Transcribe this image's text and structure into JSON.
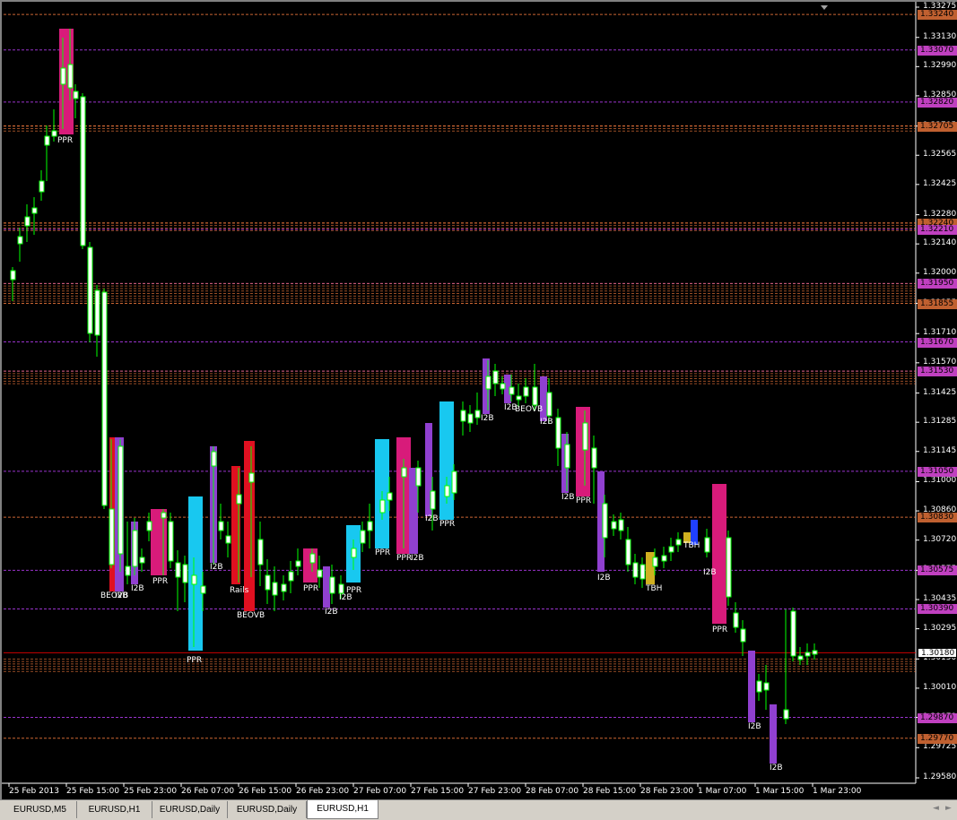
{
  "chart": {
    "symbol": "EURUSD",
    "timeframe": "H1",
    "colors": {
      "background": "#000000",
      "bull_candle": "#ffffff",
      "candle_outline": "#00ff00",
      "level_purple": "#c040ff",
      "level_orange": "#ff8040",
      "current_price_line": "#ff0000"
    }
  },
  "price_axis": {
    "labels": [
      "1.33275",
      "1.33130",
      "1.32990",
      "1.32850",
      "1.32705",
      "1.32565",
      "1.32425",
      "1.32280",
      "1.32140",
      "1.32000",
      "1.31855",
      "1.31710",
      "1.31570",
      "1.31425",
      "1.31285",
      "1.31145",
      "1.31000",
      "1.30860",
      "1.30720",
      "1.30575",
      "1.30435",
      "1.30295",
      "1.30150",
      "1.30010",
      "1.29870",
      "1.29725",
      "1.29580"
    ],
    "tags": [
      {
        "text": "1.33240",
        "color": "#c06030"
      },
      {
        "text": "1.33070",
        "color": "#c040c0"
      },
      {
        "text": "1.32820",
        "color": "#c040c0"
      },
      {
        "text": "1.32705",
        "color": "#c06030"
      },
      {
        "text": "1.32240",
        "color": "#c06030"
      },
      {
        "text": "1.32210",
        "color": "#c040c0"
      },
      {
        "text": "1.31950",
        "color": "#c040c0"
      },
      {
        "text": "1.31855",
        "color": "#c06030"
      },
      {
        "text": "1.31670",
        "color": "#c040c0"
      },
      {
        "text": "1.31530",
        "color": "#c040c0"
      },
      {
        "text": "1.31050",
        "color": "#c040c0"
      },
      {
        "text": "1.30830",
        "color": "#c06030"
      },
      {
        "text": "1.30575",
        "color": "#c040c0"
      },
      {
        "text": "1.30390",
        "color": "#c040c0"
      },
      {
        "text": "1.30180",
        "color": "#ffffff"
      },
      {
        "text": "1.29870",
        "color": "#c040c0"
      },
      {
        "text": "1.29770",
        "color": "#c06030"
      }
    ]
  },
  "time_axis": {
    "labels": [
      "25 Feb 2013",
      "25 Feb 15:00",
      "25 Feb 23:00",
      "26 Feb 07:00",
      "26 Feb 15:00",
      "26 Feb 23:00",
      "27 Feb 07:00",
      "27 Feb 15:00",
      "27 Feb 23:00",
      "28 Feb 07:00",
      "28 Feb 15:00",
      "28 Feb 23:00",
      "1 Mar 07:00",
      "1 Mar 15:00",
      "1 Mar 23:00"
    ]
  },
  "pattern_labels": [
    {
      "text": "PPR"
    },
    {
      "text": "BEOVB"
    },
    {
      "text": "I2B"
    },
    {
      "text": "I2B"
    },
    {
      "text": "PPR"
    },
    {
      "text": "PPR"
    },
    {
      "text": "I2B"
    },
    {
      "text": "Rails"
    },
    {
      "text": "BEOVB"
    },
    {
      "text": "PPR"
    },
    {
      "text": "I2B"
    },
    {
      "text": "I2B"
    },
    {
      "text": "PPR"
    },
    {
      "text": "PPR"
    },
    {
      "text": "PPR"
    },
    {
      "text": "I2B"
    },
    {
      "text": "I2B"
    },
    {
      "text": "PPR"
    },
    {
      "text": "I2B"
    },
    {
      "text": "I2B"
    },
    {
      "text": "BEOVB"
    },
    {
      "text": "I2B"
    },
    {
      "text": "I2B"
    },
    {
      "text": "PPR"
    },
    {
      "text": "I2B"
    },
    {
      "text": "TBH"
    },
    {
      "text": "TBH"
    },
    {
      "text": "I2B"
    },
    {
      "text": "PPR"
    },
    {
      "text": "I2B"
    },
    {
      "text": "I2B"
    }
  ],
  "tabs": [
    {
      "label": "EURUSD,M5"
    },
    {
      "label": "EURUSD,H1"
    },
    {
      "label": "EURUSD,Daily"
    },
    {
      "label": "EURUSD,Daily"
    },
    {
      "label": "EURUSD,H1",
      "active": true
    }
  ]
}
